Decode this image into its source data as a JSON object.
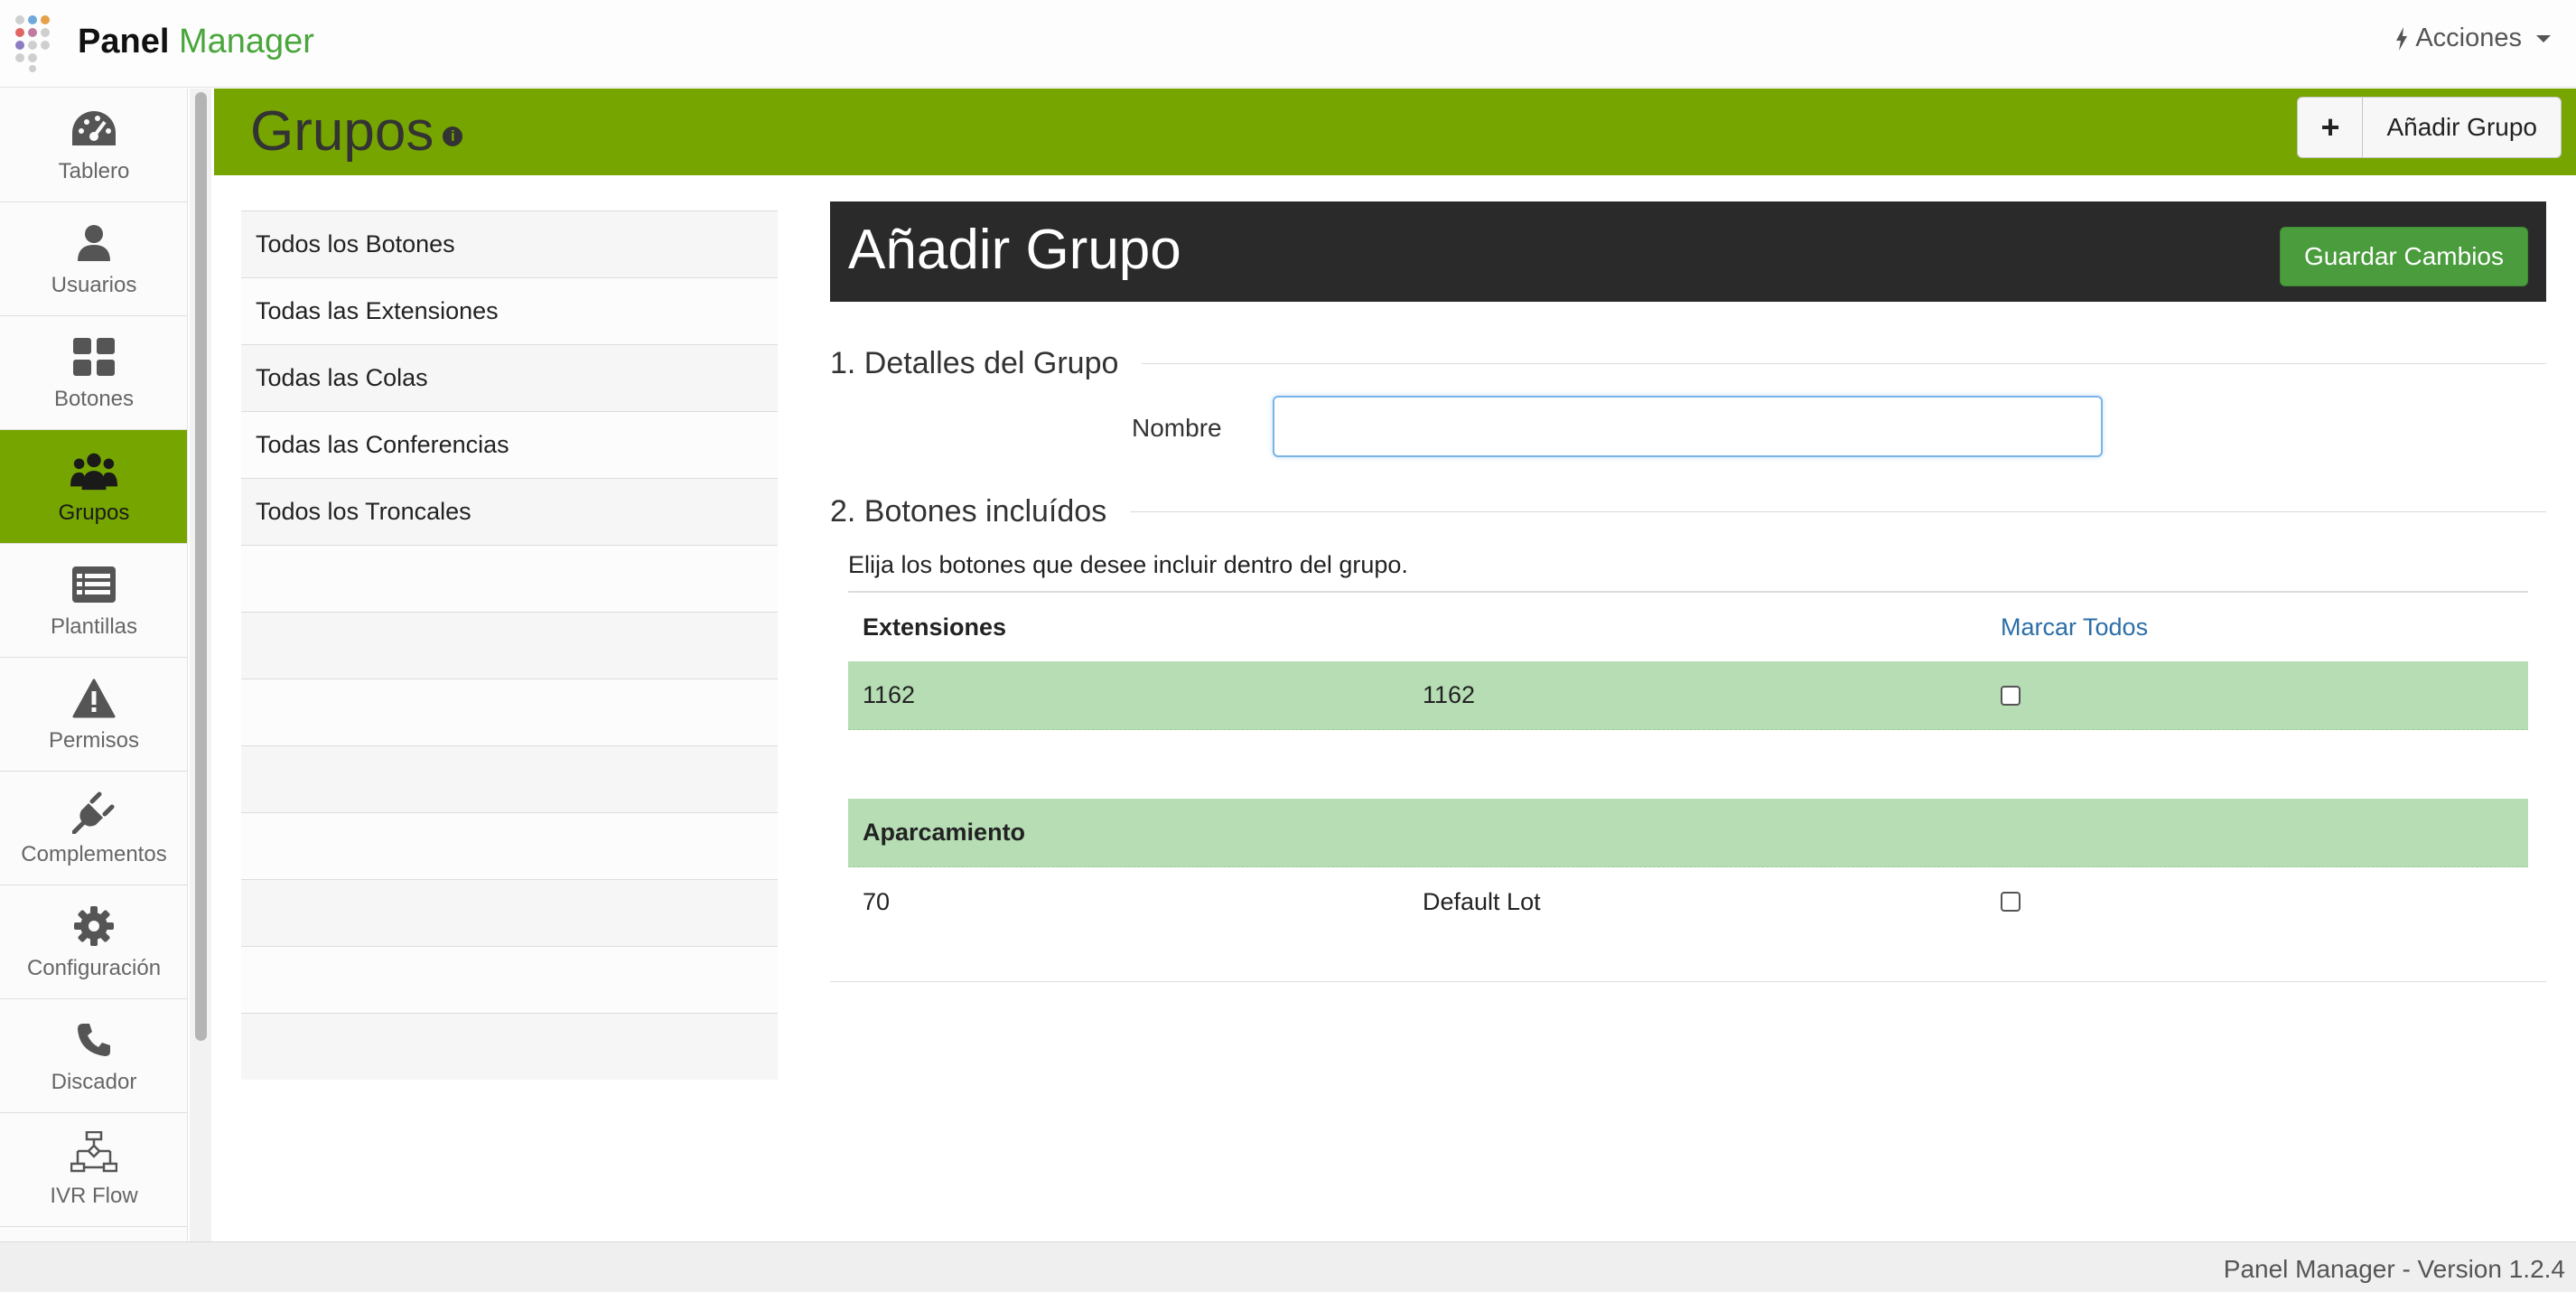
{
  "app": {
    "brand_bold": "Panel",
    "brand_light": "Manager",
    "actions_label": "Acciones"
  },
  "sidebar": {
    "items": [
      {
        "label": "Tablero",
        "icon": "dashboard-icon"
      },
      {
        "label": "Usuarios",
        "icon": "user-icon"
      },
      {
        "label": "Botones",
        "icon": "grid-icon"
      },
      {
        "label": "Grupos",
        "icon": "group-icon",
        "active": true
      },
      {
        "label": "Plantillas",
        "icon": "list-icon"
      },
      {
        "label": "Permisos",
        "icon": "warning-icon"
      },
      {
        "label": "Complementos",
        "icon": "plug-icon"
      },
      {
        "label": "Configuración",
        "icon": "gear-icon"
      },
      {
        "label": "Discador",
        "icon": "phone-icon"
      },
      {
        "label": "IVR Flow",
        "icon": "flowchart-icon"
      }
    ]
  },
  "header": {
    "title": "Grupos",
    "info_glyph": "i",
    "add_button_plus": "+",
    "add_button_label": "Añadir Grupo"
  },
  "left_list": {
    "items": [
      "Todos los Botones",
      "Todas las Extensiones",
      "Todas las Colas",
      "Todas las Conferencias",
      "Todos los Troncales"
    ]
  },
  "form": {
    "title": "Añadir Grupo",
    "save_label": "Guardar Cambios",
    "section1": "1. Detalles del Grupo",
    "name_label": "Nombre",
    "name_value": "",
    "section2": "2. Botones incluídos",
    "description": "Elija los botones que desee incluir dentro del grupo.",
    "extensions": {
      "header": "Extensiones",
      "mark_all": "Marcar Todos",
      "rows": [
        {
          "number": "1162",
          "name": "1162",
          "checked": false
        }
      ]
    },
    "parking": {
      "header": "Aparcamiento",
      "rows": [
        {
          "number": "70",
          "name": "Default Lot",
          "checked": false
        }
      ]
    }
  },
  "footer": {
    "version": "Panel Manager - Version 1.2.4"
  },
  "colors": {
    "accent_green": "#76a500",
    "brand_green": "#4aa63c",
    "save_button": "#4a9c3d",
    "row_highlight": "#b6ddb4",
    "link_blue": "#2b6ea8"
  }
}
